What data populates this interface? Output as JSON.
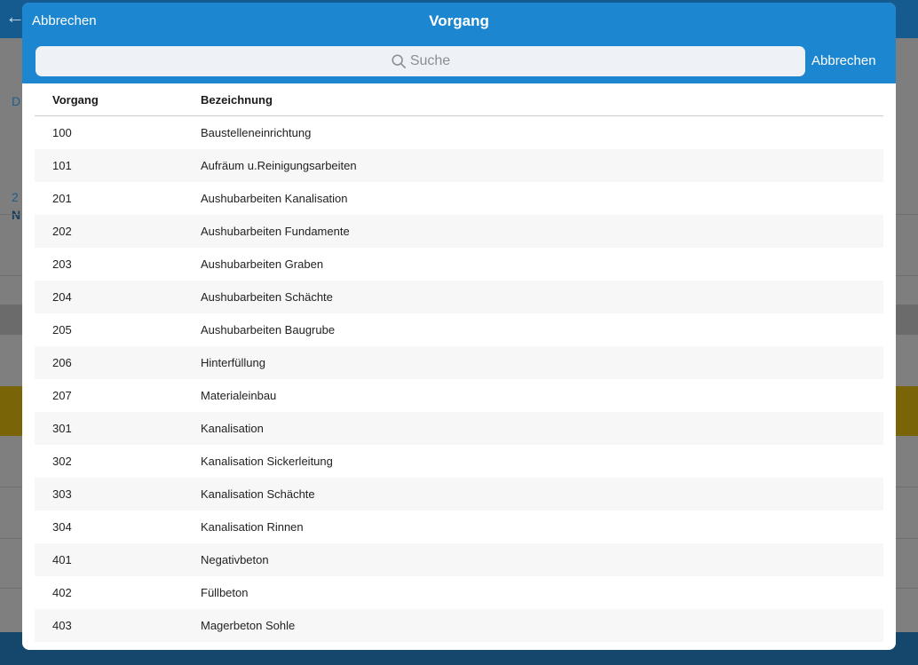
{
  "modal": {
    "title": "Vorgang",
    "cancel_label": "Abbrechen",
    "search": {
      "placeholder": "Suche",
      "cancel_label": "Abbrechen"
    },
    "table": {
      "headers": [
        "Vorgang",
        "Bezeichnung"
      ],
      "rows": [
        {
          "code": "100",
          "desc": "Baustelleneinrichtung"
        },
        {
          "code": "101",
          "desc": "Aufräum u.Reinigungsarbeiten"
        },
        {
          "code": "201",
          "desc": "Aushubarbeiten Kanalisation"
        },
        {
          "code": "202",
          "desc": "Aushubarbeiten Fundamente"
        },
        {
          "code": "203",
          "desc": "Aushubarbeiten Graben"
        },
        {
          "code": "204",
          "desc": "Aushubarbeiten Schächte"
        },
        {
          "code": "205",
          "desc": "Aushubarbeiten Baugrube"
        },
        {
          "code": "206",
          "desc": "Hinterfüllung"
        },
        {
          "code": "207",
          "desc": "Materialeinbau"
        },
        {
          "code": "301",
          "desc": "Kanalisation"
        },
        {
          "code": "302",
          "desc": "Kanalisation Sickerleitung"
        },
        {
          "code": "303",
          "desc": "Kanalisation Schächte"
        },
        {
          "code": "304",
          "desc": "Kanalisation Rinnen"
        },
        {
          "code": "401",
          "desc": "Negativbeton"
        },
        {
          "code": "402",
          "desc": "Füllbeton"
        },
        {
          "code": "403",
          "desc": "Magerbeton Sohle"
        }
      ]
    }
  },
  "background": {
    "back_icon": "arrow-left-icon",
    "partial_text": [
      "D",
      "2",
      "N"
    ]
  },
  "colors": {
    "header": "#1c87d0",
    "search_bg": "#eef2f6",
    "row_alt": "#f7f7f7"
  }
}
